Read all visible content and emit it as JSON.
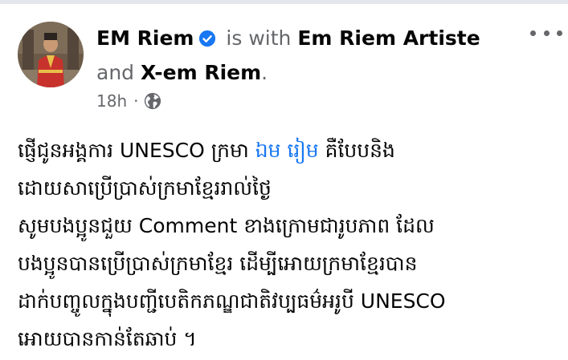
{
  "post": {
    "author": "EM Riem",
    "with_text": " is with ",
    "tagged_1": "Em Riem Artiste",
    "and_text": "and",
    "tagged_2": "X-em Riem",
    "period": ".",
    "time": "18h",
    "separator": "·",
    "privacy_icon": "globe-icon",
    "verified_icon": "verified-badge-icon",
    "more_icon": "more-options-icon",
    "body_lines": [
      {
        "text": "ផ្ញើជូនអង្គការ UNESCO ក្រមា ",
        "mention": "ឯម រៀម",
        "after": " គឺបែបនិង"
      },
      {
        "text": "ដោយសាប្រើប្រាស់ក្រមាខ្មែររាល់ថ្ងៃ"
      },
      {
        "text": "សូមបងប្អូនជួយ Comment ខាងក្រោមជារូបភាព ដែល"
      },
      {
        "text": "បងប្អូនបានប្រើប្រាស់ក្រមាខ្មែរ ដើម្បីអោយក្រមាខ្មែរបាន"
      },
      {
        "text": "ដាក់បញ្ចូលក្នុងបញ្ជីបេតិកភណ្ឌជាតិវប្បធម៌អរូបី UNESCO"
      },
      {
        "text": "អោយបានកាន់តែឆាប់ ។"
      }
    ]
  },
  "colors": {
    "text": "#050505",
    "muted": "#65676b",
    "link": "#1877f2",
    "verified": "#1877f2",
    "divider": "#e4e6eb"
  }
}
